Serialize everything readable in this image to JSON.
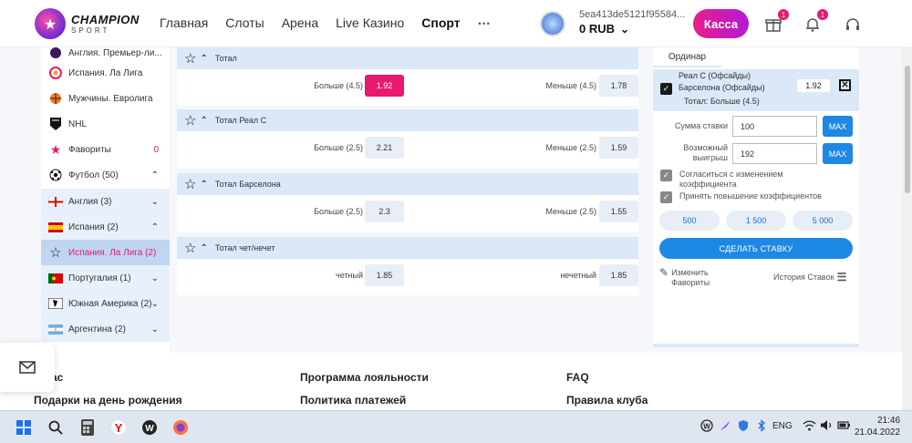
{
  "header": {
    "logo_title": "CHAMPION",
    "logo_sub": "SPORT",
    "nav": [
      "Главная",
      "Слоты",
      "Арена",
      "Live Казино",
      "Спорт"
    ],
    "nav_more": "⋯",
    "account_id": "5ea413de5121f95584...",
    "balance": "0 RUB",
    "cashier_label": "Касса",
    "gift_badge": "1",
    "bell_badge": "1"
  },
  "sidebar": {
    "items": [
      {
        "label": "Англия. Премьер-ли...",
        "icon": "pl-logo-icon"
      },
      {
        "label": "Испания. Ла Лига",
        "icon": "laliga-logo-icon"
      },
      {
        "label": "Мужчины. Евролига",
        "icon": "euroleague-logo-icon"
      },
      {
        "label": "NHL",
        "icon": "nhl-logo-icon"
      },
      {
        "label": "Фавориты",
        "count": "0",
        "icon": "star-icon"
      },
      {
        "label": "Футбол (50)",
        "icon": "football-icon"
      },
      {
        "label": "Англия (3)",
        "icon": "england-flag-icon"
      },
      {
        "label": "Испания (2)",
        "icon": "spain-flag-icon"
      },
      {
        "label": "Испания. Ла Лига (2)",
        "icon": "star-outline-icon"
      },
      {
        "label": "Португалия (1)",
        "icon": "portugal-flag-icon"
      },
      {
        "label": "Южная Америка (2)",
        "icon": "south-america-icon"
      },
      {
        "label": "Аргентина (2)",
        "icon": "argentina-flag-icon"
      }
    ]
  },
  "markets": [
    {
      "title": "Тотал",
      "left_label": "Больше (4.5)",
      "left_odd": "1.92",
      "right_label": "Меньше (4.5)",
      "right_odd": "1.78"
    },
    {
      "title": "Тотал Реал С",
      "left_label": "Больше (2.5)",
      "left_odd": "2.21",
      "right_label": "Меньше (2.5)",
      "right_odd": "1.59"
    },
    {
      "title": "Тотал Барселона",
      "left_label": "Больше (2.5)",
      "left_odd": "2.3",
      "right_label": "Меньше (2.5)",
      "right_odd": "1.55"
    },
    {
      "title": "Тотал чет/нечет",
      "left_label": "четный",
      "left_odd": "1.85",
      "right_label": "нечетный",
      "right_odd": "1.85"
    }
  ],
  "slip": {
    "tab": "Ординар",
    "event_line1": "Реал С (Офсайды)",
    "event_line2": "Барселона (Офсайды)",
    "selection": "Тотал: Больше (4.5)",
    "coef": "1.92",
    "stake_label": "Сумма ставки",
    "stake_value": "100",
    "win_label_1": "Возможный",
    "win_label_2": "выигрыш",
    "win_value": "192",
    "max_label": "MAX",
    "accept_change_1": "Согласиться с изменением",
    "accept_change_2": "коэффициента",
    "accept_raise": "Принять повышение коэффициентов",
    "quick": [
      "500",
      "1 500",
      "5 000"
    ],
    "make_bet": "СДЕЛАТЬ СТАВКУ",
    "edit_fav_1": "Изменить",
    "edit_fav_2": "Фавориты",
    "history": "История Ставок"
  },
  "footer": {
    "col1_a": "ас",
    "col1_b": "Подарки на день рождения",
    "col2_a": "Программа лояльности",
    "col2_b": "Политика платежей",
    "col3_a": "FAQ",
    "col3_b": "Правила клуба"
  },
  "taskbar": {
    "lang": "ENG",
    "time": "21:46",
    "date": "21.04.2022"
  }
}
